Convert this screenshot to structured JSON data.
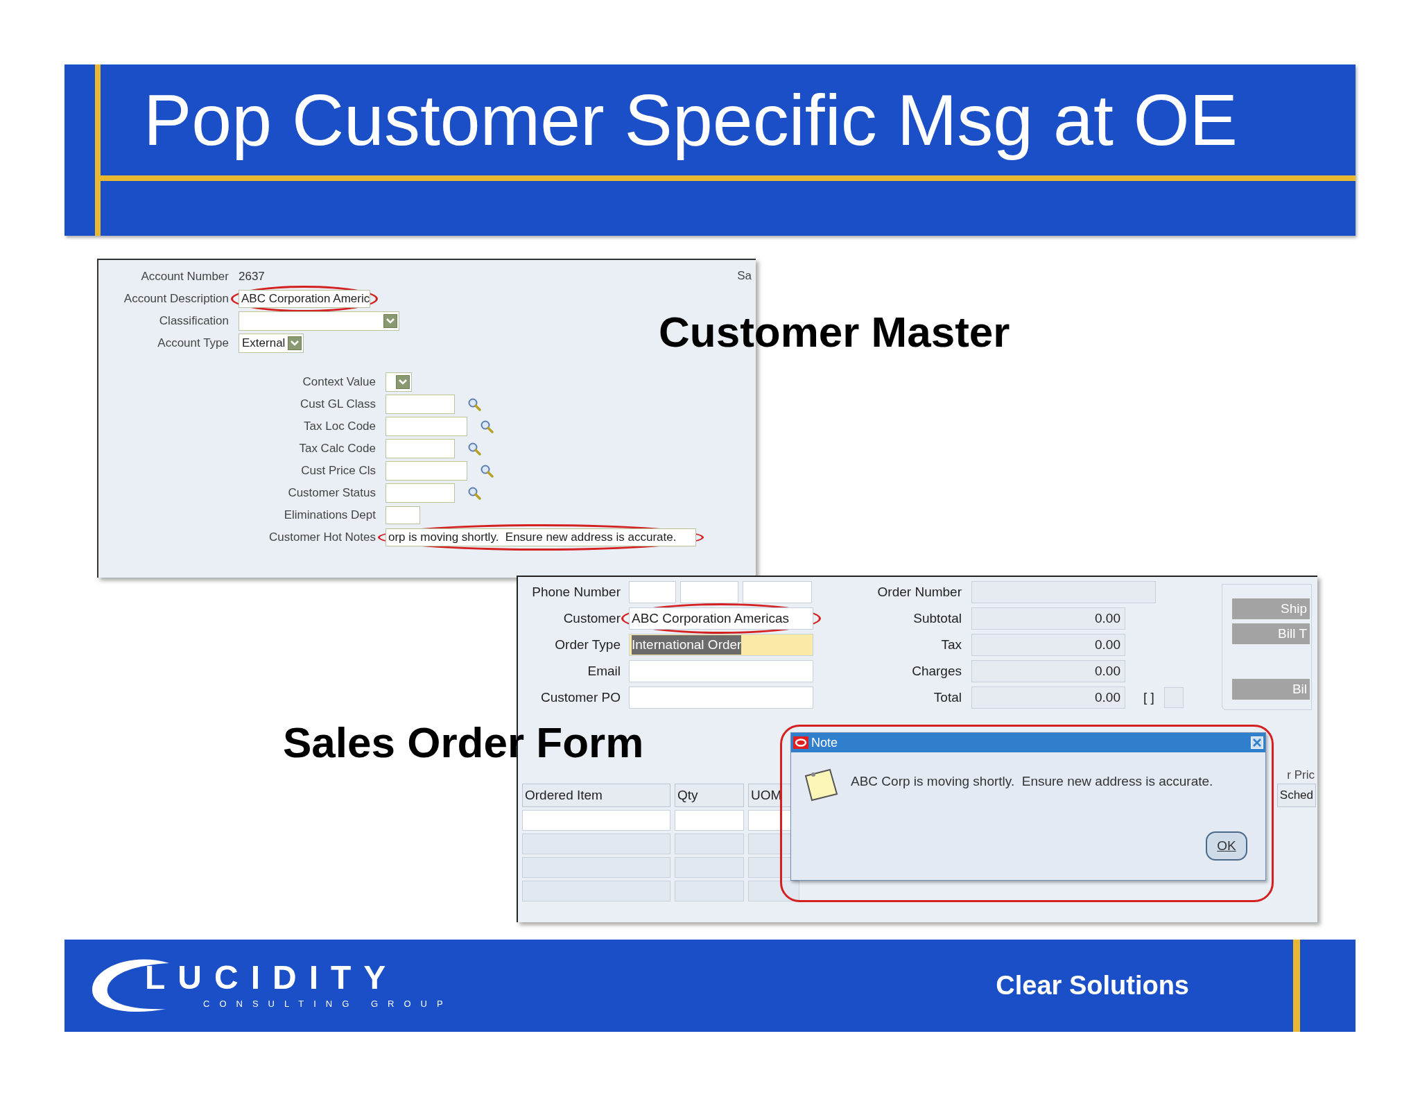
{
  "title": "Pop Customer Specific Msg at OE",
  "customer_master": {
    "caption": "Customer Master",
    "corner_text": "Sa",
    "groups": [
      {
        "fields": [
          {
            "label": "Account Number",
            "kind": "text",
            "value": "2637",
            "circled": false
          },
          {
            "label": "Account Description",
            "kind": "input",
            "value": "ABC Corporation Americ",
            "circled": true
          },
          {
            "label": "Classification",
            "kind": "select",
            "circled": false
          },
          {
            "label": "Account Type",
            "kind": "select",
            "value": "External",
            "circled": false
          }
        ]
      },
      {
        "fields": [
          {
            "label": "Context Value",
            "kind": "select",
            "circled": false
          },
          {
            "label": "Cust GL Class",
            "kind": "lookup",
            "circled": false
          },
          {
            "label": "Tax Loc Code",
            "kind": "lookup",
            "circled": false
          },
          {
            "label": "Tax Calc Code",
            "kind": "lookup",
            "circled": false
          },
          {
            "label": "Cust Price Cls",
            "kind": "lookup",
            "circled": false
          },
          {
            "label": "Customer Status",
            "kind": "lookup",
            "circled": false
          },
          {
            "label": "Eliminations Dept",
            "kind": "input",
            "circled": false
          },
          {
            "label": "Customer Hot Notes",
            "kind": "input",
            "value": "orp is moving shortly.  Ensure new address is accurate.",
            "circled": true
          }
        ]
      }
    ]
  },
  "sales_order": {
    "caption": "Sales Order Form",
    "left_fields": [
      {
        "label": "Phone Number",
        "kind": "phone",
        "circled": false,
        "selected": false
      },
      {
        "label": "Customer",
        "kind": "input",
        "value": "ABC Corporation Americas",
        "circled": true,
        "selected": false
      },
      {
        "label": "Order Type",
        "kind": "input",
        "value": "International Order",
        "circled": false,
        "selected": true
      },
      {
        "label": "Email",
        "kind": "input",
        "circled": false,
        "selected": false
      },
      {
        "label": "Customer PO",
        "kind": "input",
        "circled": false,
        "selected": false
      }
    ],
    "right_fields": [
      {
        "label": "Order Number"
      },
      {
        "label": "Subtotal",
        "value": "0.00"
      },
      {
        "label": "Tax",
        "value": "0.00"
      },
      {
        "label": "Charges",
        "value": "0.00"
      },
      {
        "label": "Total",
        "value": "0.00"
      }
    ],
    "total_marker": "[ ]",
    "side_buttons": [
      "Ship",
      "Bill T",
      "Bil"
    ],
    "table": {
      "columns": [
        "Ordered Item",
        "Qty",
        "UOM",
        "Sched"
      ],
      "header_above": "r Pric"
    },
    "note_dialog": {
      "title": "Note",
      "message": "ABC Corp is moving shortly.  Ensure new address is accurate.",
      "button": "OK",
      "circled": true
    }
  },
  "footer": {
    "logo": "LUCIDITY",
    "logo_sub": "CONSULTING GROUP",
    "slogan": "Clear Solutions"
  }
}
